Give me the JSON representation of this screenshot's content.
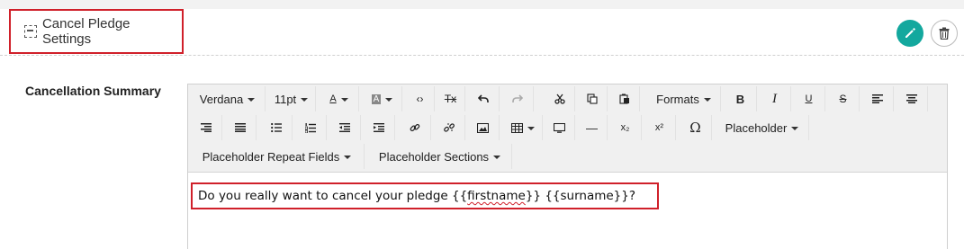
{
  "header": {
    "title": "Cancel Pledge Settings",
    "edit_icon": "pencil-icon",
    "delete_icon": "trash-icon",
    "accent": "#13a89e",
    "highlight": "#d0202a"
  },
  "field": {
    "label": "Cancellation Summary"
  },
  "toolbar": {
    "font_family": "Verdana",
    "font_size": "11pt",
    "formats": "Formats",
    "placeholder": "Placeholder",
    "placeholder_repeat": "Placeholder Repeat Fields",
    "placeholder_sections": "Placeholder Sections",
    "text_color_glyph": "A",
    "bg_color_glyph": "A",
    "code_glyph": "‹›",
    "clear_format_glyph": "Tx",
    "bold_glyph": "B",
    "italic_glyph": "I",
    "underline_glyph": "U",
    "strike_glyph": "S",
    "subscript_glyph": "x₂",
    "superscript_glyph": "x²",
    "omega_glyph": "Ω",
    "hr_glyph": "—"
  },
  "editor": {
    "before": "Do you really want to cancel your pledge {{",
    "misspelled": "firstname",
    "after": "}} {{surname}}?"
  }
}
